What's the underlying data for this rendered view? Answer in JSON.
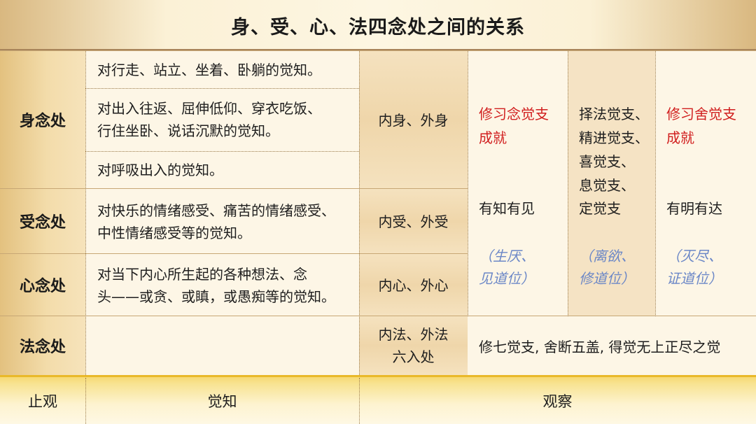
{
  "title": "身、受、心、法四念处之间的关系",
  "rows": {
    "body": {
      "label": "身念处",
      "desc1": "对行走、站立、坐着、卧躺的觉知。",
      "desc2_line1": "对出入往返、屈伸低仰、穿衣吃饭、",
      "desc2_line2": "行住坐卧、说话沉默的觉知。",
      "desc3": "对呼吸出入的觉知。",
      "inner": "内身、外身"
    },
    "feeling": {
      "label": "受念处",
      "desc_line1": "对快乐的情绪感受、痛苦的情绪感受、",
      "desc_line2": "中性情绪感受等的觉知。",
      "inner": "内受、外受"
    },
    "mind": {
      "label": "心念处",
      "desc_line1": "对当下内心所生起的各种想法、念",
      "desc_line2": "头——或贪、或瞋，或愚痴等的觉知。",
      "inner": "内心、外心"
    },
    "dharma": {
      "label": "法念处",
      "desc": "",
      "inner_line1": "内法、外法",
      "inner_line2": "六入处",
      "summary": "修七觉支, 舍断五盖, 得觉无上正尽之觉"
    }
  },
  "factors": {
    "col1": {
      "red_line1": "修习念觉支",
      "red_line2": "成就",
      "black": "有知有见",
      "blue_line1": "（生厌、",
      "blue_line2": "见道位）"
    },
    "col2": {
      "line1": "择法觉支、",
      "line2": "精进觉支、",
      "line3": "喜觉支、",
      "line4": "息觉支、",
      "line5": "定觉支",
      "blue_line1": "（离欲、",
      "blue_line2": "修道位）"
    },
    "col3": {
      "red_line1": "修习舍觉支",
      "red_line2": "成就",
      "black": "有明有达",
      "blue_line1": "（灭尽、",
      "blue_line2": "证道位）"
    }
  },
  "footer": {
    "col1": "止观",
    "col2": "觉知",
    "col3": "观察"
  },
  "colors": {
    "red": "#d11f1f",
    "blue": "#6b87c7",
    "gold": "#e3c17f"
  }
}
